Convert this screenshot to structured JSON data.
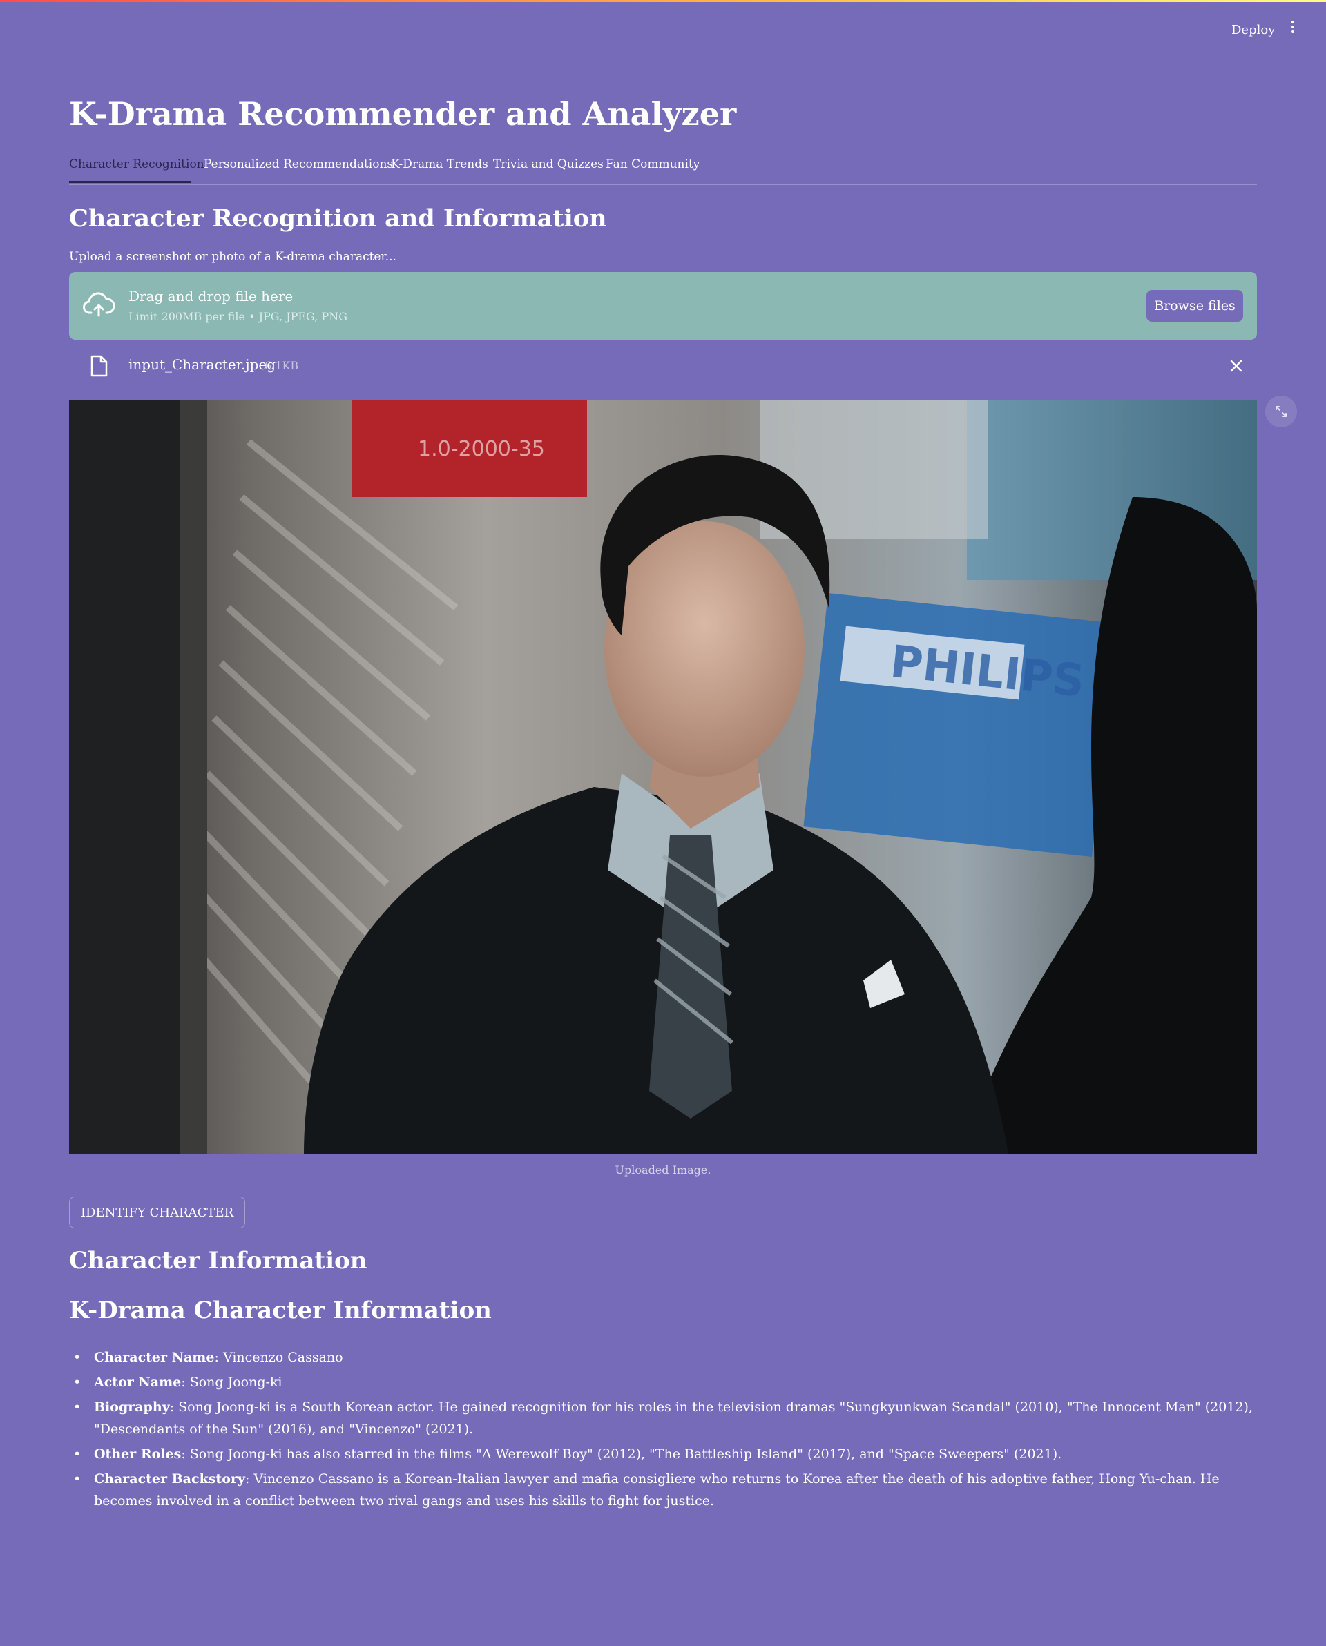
{
  "header": {
    "deploy_label": "Deploy",
    "menu_icon": "more-vertical-icon"
  },
  "app": {
    "title": "K-Drama Recommender and Analyzer"
  },
  "tabs": [
    {
      "label": "Character Recognition",
      "active": true
    },
    {
      "label": "Personalized Recommendations",
      "active": false
    },
    {
      "label": "K-Drama Trends",
      "active": false
    },
    {
      "label": "Trivia and Quizzes",
      "active": false
    },
    {
      "label": "Fan Community",
      "active": false
    }
  ],
  "section": {
    "title": "Character Recognition and Information"
  },
  "uploader": {
    "label": "Upload a screenshot or photo of a K-drama character...",
    "drop_title": "Drag and drop file here",
    "drop_subtitle": "Limit 200MB per file • JPG, JPEG, PNG",
    "browse_label": "Browse files",
    "icon": "cloud-upload-icon"
  },
  "uploaded_file": {
    "name": "input_Character.jpeg",
    "size": "6.1KB",
    "icon": "file-icon",
    "remove_icon": "close-icon"
  },
  "image": {
    "caption": "Uploaded Image."
  },
  "actions": {
    "identify_label": "IDENTIFY CHARACTER"
  },
  "results": {
    "heading": "Character Information",
    "subheading": "K-Drama Character Information",
    "items": [
      {
        "key": "Character Name",
        "value": ": Vincenzo Cassano"
      },
      {
        "key": "Actor Name",
        "value": ": Song Joong-ki"
      },
      {
        "key": "Biography",
        "value": ": Song Joong-ki is a South Korean actor. He gained recognition for his roles in the television dramas \"Sungkyunkwan Scandal\" (2010), \"The Innocent Man\" (2012), \"Descendants of the Sun\" (2016), and \"Vincenzo\" (2021)."
      },
      {
        "key": "Other Roles",
        "value": ": Song Joong-ki has also starred in the films \"A Werewolf Boy\" (2012), \"The Battleship Island\" (2017), and \"Space Sweepers\" (2021)."
      },
      {
        "key": "Character Backstory",
        "value": ": Vincenzo Cassano is a Korean-Italian lawyer and mafia consigliere who returns to Korea after the death of his adoptive father, Hong Yu-chan. He becomes involved in a conflict between two rival gangs and uses his skills to fight for justice."
      }
    ]
  },
  "colors": {
    "background": "#766bb8",
    "dropzone": "#8bb8b3",
    "active_tab": "#2a2550"
  }
}
